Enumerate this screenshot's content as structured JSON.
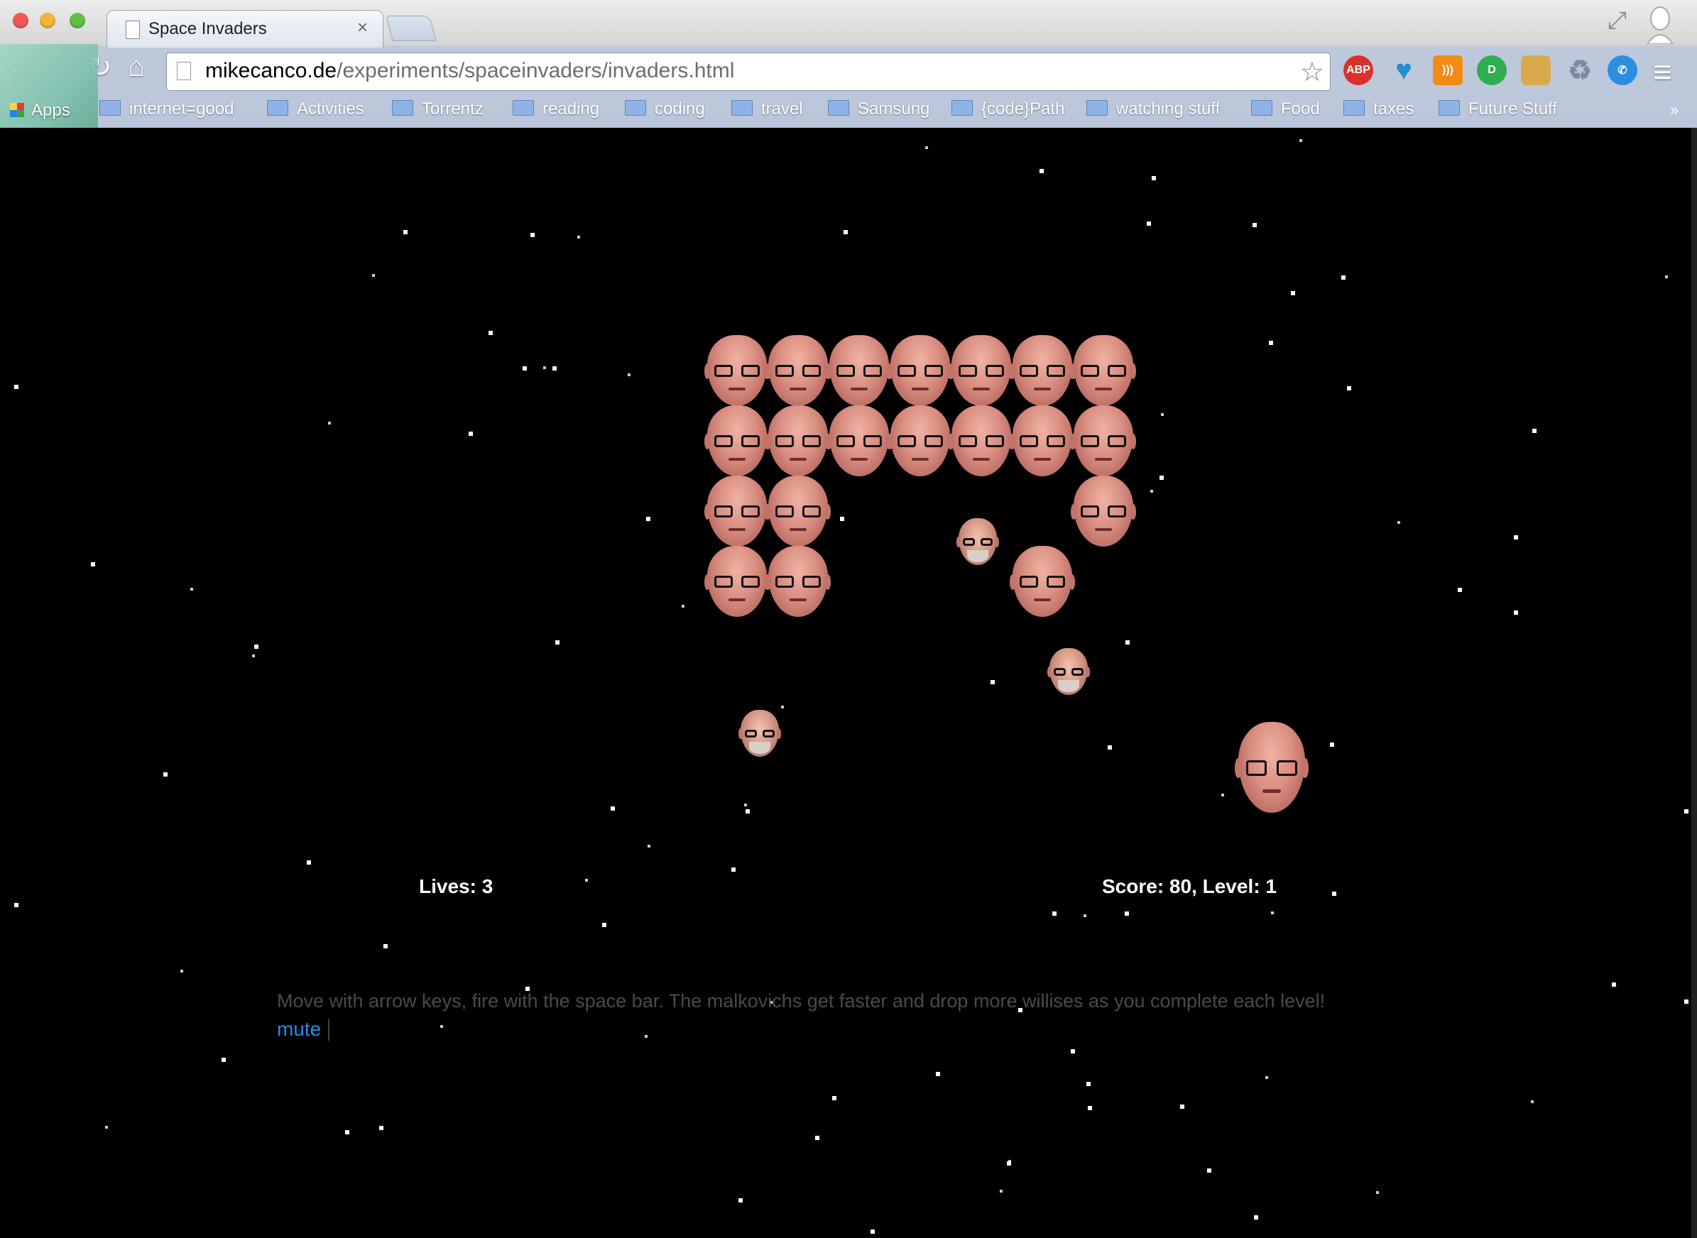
{
  "tab": {
    "title": "Space Invaders",
    "close": "×"
  },
  "url": {
    "host": "mikecanco.de",
    "path": "/experiments/spaceinvaders/invaders.html"
  },
  "toolbar": {
    "back": "←",
    "reload": "↻",
    "home": "⌂",
    "star": "☆",
    "menu": "≡"
  },
  "extensions": [
    {
      "name": "adblock-plus-icon",
      "label": "ABP"
    },
    {
      "name": "ghostery-icon",
      "label": "♥"
    },
    {
      "name": "rss-icon",
      "label": ")))"
    },
    {
      "name": "d-extension-icon",
      "label": "D"
    },
    {
      "name": "doge-icon",
      "label": ""
    },
    {
      "name": "recycle-icon",
      "label": "♻"
    },
    {
      "name": "chat-icon",
      "label": "✆"
    }
  ],
  "bookmarks": {
    "apps": "Apps",
    "items": [
      "internet=good",
      "Activities",
      "Torrentz",
      "reading",
      "coding",
      "travel",
      "Samsung",
      "{code}Path",
      "watching stuff",
      "Food",
      "taxes",
      "Future Stuff"
    ],
    "more": "»"
  },
  "game": {
    "lives_text": "Lives: 3",
    "score_text": "Score: 80, Level: 1",
    "lives": 3,
    "score": 80,
    "level": 1,
    "instructions": "Move with arrow keys, fire with the space bar. The malkovichs get faster and drop more willises as you complete each level!",
    "mute_label": "mute",
    "invader_grid": {
      "columns": 7,
      "rows": 4,
      "alive": [
        [
          true,
          true,
          true,
          true,
          true,
          true,
          true
        ],
        [
          true,
          true,
          true,
          true,
          true,
          true,
          true
        ],
        [
          true,
          true,
          false,
          false,
          false,
          false,
          true
        ],
        [
          true,
          true,
          false,
          false,
          false,
          true,
          false
        ]
      ]
    },
    "falling_bomb_count": 3
  }
}
